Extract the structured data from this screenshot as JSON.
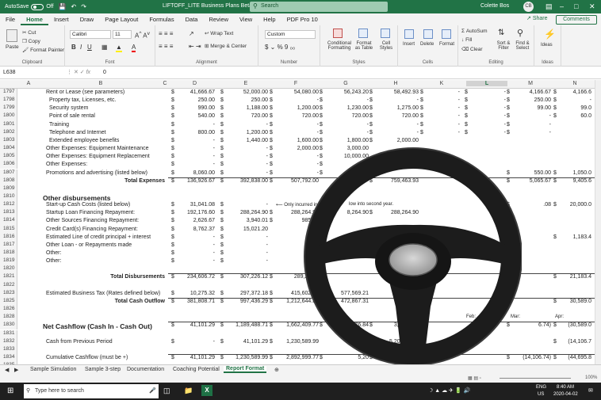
{
  "titlebar": {
    "autosave": "AutoSave",
    "autosave_state": "Off",
    "doc_title": "LIFTOFF_LITE Business Plans Beta",
    "search_placeholder": "Search",
    "user": "Colette Bos",
    "avatar": "CB"
  },
  "tabs": [
    "File",
    "Home",
    "Insert",
    "Draw",
    "Page Layout",
    "Formulas",
    "Data",
    "Review",
    "View",
    "Help",
    "PDF Pro 10"
  ],
  "ribbon": {
    "share": "Share",
    "comments": "Comments",
    "clipboard": {
      "paste": "Paste",
      "cut": "Cut",
      "copy": "Copy",
      "format_painter": "Format Painter",
      "label": "Clipboard"
    },
    "font": {
      "name": "Calibri",
      "size": "11",
      "label": "Font"
    },
    "alignment": {
      "wrap": "Wrap Text",
      "merge": "Merge & Center",
      "label": "Alignment"
    },
    "number": {
      "format": "Custom",
      "label": "Number"
    },
    "styles": {
      "cond": "Conditional Formatting",
      "table": "Format as Table",
      "cell": "Cell Styles",
      "label": "Styles"
    },
    "cells": {
      "insert": "Insert",
      "delete": "Delete",
      "format": "Format",
      "label": "Cells"
    },
    "editing": {
      "autosum": "AutoSum",
      "fill": "Fill",
      "clear": "Clear",
      "sort": "Sort & Filter",
      "find": "Find & Select",
      "label": "Editing"
    },
    "ideas": {
      "label": "Ideas"
    }
  },
  "formula_bar": {
    "name_box": "L638",
    "value": "0"
  },
  "columns": [
    "A",
    "B",
    "C",
    "D",
    "E",
    "F",
    "G",
    "H",
    "K",
    "L",
    "M",
    "N"
  ],
  "rows": [
    {
      "n": "1797",
      "label": "Rent or Lease (see parameters)",
      "ind": 1,
      "d": "41,666.67",
      "e": "52,000.00",
      "f": "54,080.00",
      "g": "56,243.20",
      "h": "58,492.93",
      "k": "-",
      "l": "-",
      "m": "4,166.67",
      "nn": "4,166.6"
    },
    {
      "n": "1798",
      "label": "Property tax, Licenses, etc.",
      "ind": 2,
      "d": "250.00",
      "e": "250.00",
      "f": "-",
      "g": "-",
      "h": "-",
      "k": "-",
      "l": "-",
      "m": "250.00",
      "nn": "-"
    },
    {
      "n": "1799",
      "label": "Security system",
      "ind": 2,
      "d": "990.00",
      "e": "1,188.00",
      "f": "1,200.00",
      "g": "1,230.00",
      "h": "1,275.00",
      "k": "-",
      "l": "-",
      "m": "99.00",
      "nn": "99.0"
    },
    {
      "n": "1800",
      "label": "Point of sale rental",
      "ind": 2,
      "d": "540.00",
      "e": "720.00",
      "f": "720.00",
      "g": "720.00",
      "h": "720.00",
      "k": "-",
      "l": "-",
      "m": "-",
      "nn": "60.0"
    },
    {
      "n": "1801",
      "label": "Training",
      "ind": 2,
      "d": "-",
      "e": "-",
      "f": "-",
      "g": "-",
      "h": "-",
      "k": "-",
      "l": "-",
      "m": "-",
      "nn": ""
    },
    {
      "n": "1802",
      "label": "Telephone and Internet",
      "ind": 2,
      "d": "800.00",
      "e": "1,200.00",
      "f": "-",
      "g": "-",
      "h": "-",
      "k": "-",
      "l": "-",
      "m": "-",
      "nn": ""
    },
    {
      "n": "1803",
      "label": "Extended employee benefits",
      "ind": 2,
      "d": "-",
      "e": "1,440.00",
      "f": "1,600.00",
      "g": "1,800.00",
      "h": "2,000.00",
      "k": "",
      "l": "",
      "m": "",
      "nn": ""
    },
    {
      "n": "1804",
      "label": "Other Expenses: Equipment Maintenance",
      "ind": 1,
      "d": "-",
      "e": "-",
      "f": "2,000.00",
      "g": "3,000.00",
      "h": "",
      "k": "",
      "l": "",
      "m": "",
      "nn": ""
    },
    {
      "n": "1805",
      "label": "Other Expenses: Equipment Replacement",
      "ind": 1,
      "d": "-",
      "e": "-",
      "f": "-",
      "g": "10,000.00",
      "h": "",
      "k": "",
      "l": "",
      "m": "",
      "nn": ""
    },
    {
      "n": "1806",
      "label": "Other Expenses:",
      "ind": 1,
      "d": "-",
      "e": "-",
      "f": "-",
      "g": "-",
      "h": "",
      "k": "-",
      "l": "",
      "m": "",
      "nn": ""
    },
    {
      "n": "1807",
      "label": "Promotions and advertising  (listed below)",
      "ind": 1,
      "d": "8,060.00",
      "e": "-",
      "f": "-",
      "g": "-",
      "h": "",
      "k": "",
      "l": "",
      "m": "550.00",
      "nn": "1,050.0"
    },
    {
      "n": "1808",
      "label": "Total Expenses",
      "ind": 3,
      "bold": true,
      "d": "136,926.67",
      "e": "392,838.00",
      "f": "507,792.00",
      "g": "",
      "h": "759,463.93",
      "k": "",
      "l": "",
      "m": "5,065.67",
      "nn": "9,405.6"
    },
    {
      "n": "1809",
      "label": "",
      "ind": 0,
      "d": "",
      "e": "",
      "f": "",
      "g": "",
      "h": "",
      "k": "",
      "l": "",
      "m": "",
      "nn": ""
    },
    {
      "n": "1810",
      "label": "Other disbursements",
      "ind": 0,
      "bold": true,
      "big": true,
      "d": "",
      "e": "",
      "f": "",
      "g": "",
      "h": "",
      "k": "",
      "l": "",
      "m": "",
      "nn": ""
    },
    {
      "n": "1812",
      "label": "Start-up Cash Costs (listed below)",
      "ind": 1,
      "d": "31,041.08",
      "e": "-",
      "f": "",
      "g": "",
      "h": "",
      "k": "",
      "l": "",
      "m": ".08",
      "nn": "20,000.0"
    },
    {
      "n": "1813",
      "label": "Startup Loan Financing Repayment:",
      "ind": 1,
      "d": "192,176.60",
      "e": "288,264.90",
      "f": "288,264.90",
      "g": "8,264.90",
      "h": "288,264.90",
      "k": "",
      "l": "",
      "m": "",
      "nn": ""
    },
    {
      "n": "1814",
      "label": "Other Sources Financing Repayment:",
      "ind": 1,
      "d": "2,626.67",
      "e": "3,940.01",
      "f": "985.00",
      "g": "",
      "h": "",
      "k": "",
      "l": "",
      "m": "",
      "nn": ""
    },
    {
      "n": "1815",
      "label": "Credit Card(s) Financing Repayment:",
      "ind": 1,
      "d": "8,762.37",
      "e": "15,021.20",
      "f": "",
      "g": "",
      "h": "",
      "k": "",
      "l": "",
      "m": "",
      "nn": ""
    },
    {
      "n": "1816",
      "label": "Estimated Line of credit principal + interest",
      "ind": 1,
      "d": "-",
      "e": "-",
      "f": "",
      "g": "",
      "h": "",
      "k": "",
      "l": "",
      "m": "",
      "nn": "1,183.4"
    },
    {
      "n": "1817",
      "label": "Other Loan - or Repayments made",
      "ind": 1,
      "d": "-",
      "e": "-",
      "f": "",
      "g": "",
      "h": "",
      "k": "",
      "l": "",
      "m": "",
      "nn": ""
    },
    {
      "n": "1818",
      "label": "Other:",
      "ind": 1,
      "d": "-",
      "e": "-",
      "f": "",
      "g": "",
      "h": "",
      "k": "",
      "l": "",
      "m": "",
      "nn": ""
    },
    {
      "n": "1819",
      "label": "Other:",
      "ind": 1,
      "d": "-",
      "e": "-",
      "f": "",
      "g": "",
      "h": "",
      "k": "",
      "l": "",
      "m": "",
      "nn": ""
    },
    {
      "n": "1820",
      "label": "",
      "ind": 0,
      "d": "",
      "e": "",
      "f": "",
      "g": "",
      "h": "",
      "k": "",
      "l": "",
      "m": "",
      "nn": ""
    },
    {
      "n": "1821",
      "label": "Total Disbursements",
      "ind": 3,
      "bold": true,
      "d": "234,606.72",
      "e": "307,226.12",
      "f": "289,249.9",
      "g": "",
      "h": "",
      "k": "",
      "l": "",
      "m": "",
      "nn": "21,183.4"
    },
    {
      "n": "1822",
      "label": "",
      "ind": 0,
      "d": "",
      "e": "",
      "f": "",
      "g": "",
      "h": "",
      "k": "",
      "l": "",
      "m": "",
      "nn": ""
    },
    {
      "n": "1823",
      "label": "Estimated Business Tax (Rates defined below)",
      "ind": 1,
      "d": "10,275.32",
      "e": "297,372.18",
      "f": "415,602.44",
      "g": "577,569.21",
      "h": "",
      "k": "",
      "l": "",
      "m": "",
      "nn": ""
    },
    {
      "n": "1825",
      "label": "Total Cash Outflow",
      "ind": 3,
      "bold": true,
      "d": "381,808.71",
      "e": "997,436.29",
      "f": "1,212,644.35",
      "g": "472,867.31",
      "h": "",
      "k": "",
      "l": "",
      "m": "",
      "nn": "30,589.0"
    },
    {
      "n": "1826",
      "label": "",
      "ind": 0,
      "d": "",
      "e": "",
      "f": "",
      "g": "",
      "h": "",
      "k": "",
      "l": "",
      "m": "",
      "nn": ""
    },
    {
      "n": "1828",
      "label": "",
      "ind": 0,
      "d": "",
      "e": "",
      "f": "",
      "g": "",
      "h": "",
      "k": "",
      "l": "",
      "m": "",
      "nn": ""
    },
    {
      "n": "1830",
      "label": "Net Cashflow (Cash In - Cash Out)",
      "ind": 0,
      "bold": true,
      "big": true,
      "d": "41,101.29",
      "e": "1,189,488.71",
      "f": "1,662,409.77",
      "g": "276.84",
      "h": "3,147,900",
      "k": "",
      "l": "",
      "m": "6.74)",
      "nn": "(30,589.0"
    },
    {
      "n": "1831",
      "label": "",
      "ind": 0,
      "d": "",
      "e": "",
      "f": "",
      "g": "",
      "h": "",
      "k": "",
      "l": "",
      "m": "",
      "nn": ""
    },
    {
      "n": "1832",
      "label": "Cash from Previous Period",
      "ind": 1,
      "d": "-",
      "e": "41,101.29",
      "f": "1,230,589.99",
      "g": "",
      "h": "5,203,276.6",
      "k": "",
      "l": "",
      "m": "",
      "nn": "(14,106.7"
    },
    {
      "n": "1833",
      "label": "",
      "ind": 0,
      "d": "",
      "e": "",
      "f": "",
      "g": "",
      "h": "",
      "k": "",
      "l": "",
      "m": "",
      "nn": ""
    },
    {
      "n": "1834",
      "label": "Cumulative Cashflow (must be +)",
      "ind": 1,
      "d": "41,101.29",
      "e": "1,230,589.99",
      "f": "2,892,999.77",
      "g": "5,20",
      "h": "8,351,177.02",
      "k": "",
      "l": "",
      "m": "(14,106.74)",
      "nn": "(44,695.8"
    },
    {
      "n": "1835",
      "label": "",
      "ind": 0,
      "d": "",
      "e": "",
      "f": "",
      "g": "",
      "h": "",
      "k": "",
      "l": "",
      "m": "",
      "nn": ""
    },
    {
      "n": "1836",
      "label": "Line of credit required?",
      "ind": 3,
      "bold": true,
      "d": "-",
      "e": "-",
      "f": "-",
      "g": "",
      "h": "",
      "k": "",
      "l": "",
      "m": "14,106.74",
      "nn": "44,695.8"
    },
    {
      "n": "1837",
      "label": "8% APR interest on line of credit.",
      "ind": 0,
      "d": "-",
      "e": "-",
      "f": "-",
      "g": "",
      "h": "",
      "k": "",
      "l": "",
      "m": "94.04",
      "nn": "297.9"
    }
  ],
  "notes": {
    "only_incurred": "⟵ Only incurred in first y",
    "second_year": "low into second year.",
    "feb": "Feb:",
    "mar": "Mar:",
    "apr": "Apr:"
  },
  "sheets": [
    "Sample Simulation",
    "Sample 3-step",
    "Documentation",
    "Coaching Potential",
    "Report Format"
  ],
  "active_sheet": "Report Format",
  "status": {
    "zoom": "100%"
  },
  "taskbar": {
    "search_placeholder": "Type here to search",
    "lang": "ENG",
    "region": "US",
    "time": "8:40 AM",
    "date": "2020-04-02"
  },
  "overlay": {
    "icon": "steering-wheel-icon",
    "color": "#1c1c1c"
  }
}
